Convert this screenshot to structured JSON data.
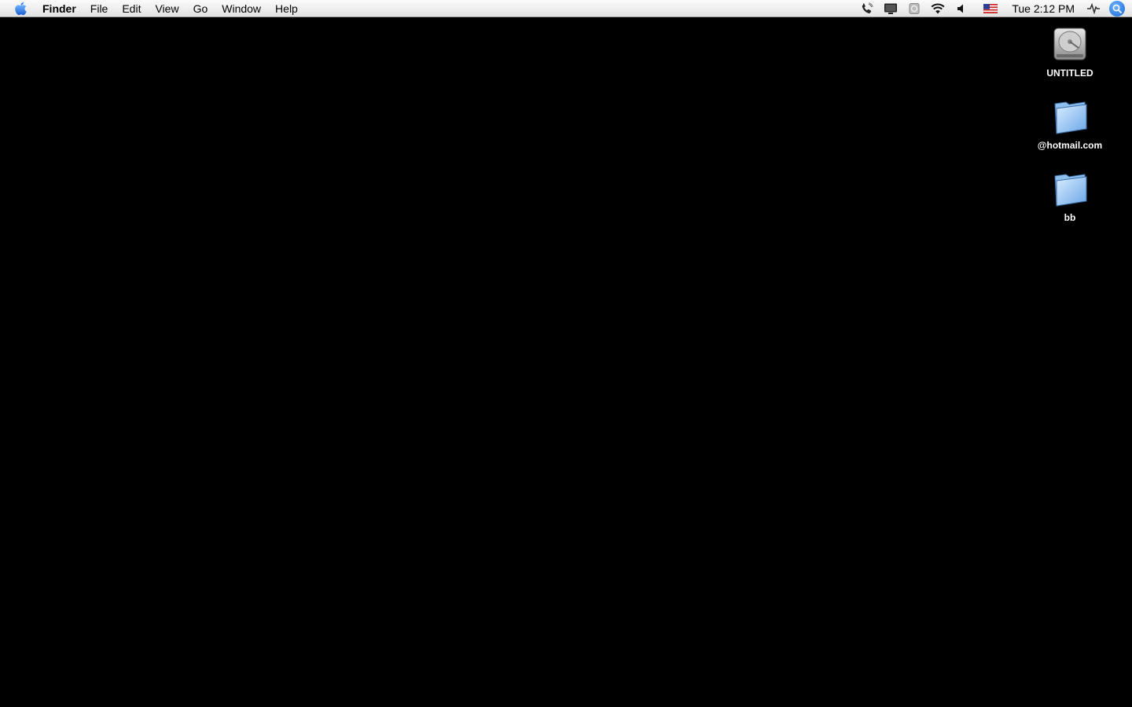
{
  "menubar": {
    "apple_icon": "apple-icon",
    "app_name": "Finder",
    "menus": [
      "File",
      "Edit",
      "View",
      "Go",
      "Window",
      "Help"
    ],
    "status_icons": [
      "phone-icon",
      "display-icon",
      "sync-icon",
      "wifi-icon",
      "volume-icon",
      "flag-icon"
    ],
    "clock": "Tue 2:12 PM",
    "spotlight_icon": "spotlight-icon"
  },
  "desktop": {
    "background": "#000000",
    "icons": [
      {
        "label": "UNTITLED",
        "icon": "hard-drive-icon"
      },
      {
        "label": "@hotmail.com",
        "icon": "folder-icon"
      },
      {
        "label": "bb",
        "icon": "folder-icon"
      }
    ]
  }
}
